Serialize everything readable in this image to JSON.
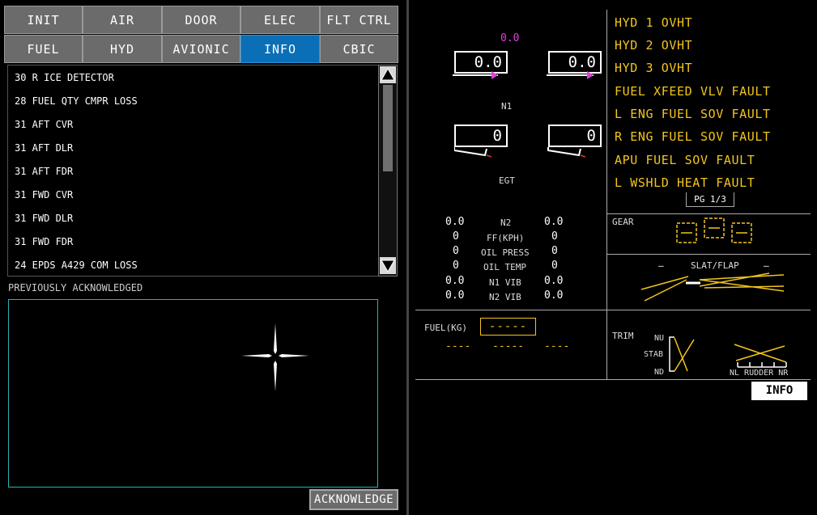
{
  "tabs_row1": [
    "INIT",
    "AIR",
    "DOOR",
    "ELEC",
    "FLT CTRL"
  ],
  "tabs_row2": [
    "FUEL",
    "HYD",
    "AVIONIC",
    "INFO",
    "CBIC"
  ],
  "active_tab": "INFO",
  "messages": [
    "30 R ICE DETECTOR",
    "28 FUEL QTY CMPR LOSS",
    "31 AFT CVR",
    "31 AFT DLR",
    "31 AFT FDR",
    "31 FWD CVR",
    "31 FWD DLR",
    "31 FWD FDR",
    "24 EPDS A429 COM LOSS"
  ],
  "prev_ack_label": "PREVIOUSLY ACKNOWLEDGED",
  "ack_button": "ACKNOWLEDGE",
  "engine": {
    "top_magenta": "0.0",
    "n1_left": "0.0",
    "n1_right": "0.0",
    "n1_label": "N1",
    "egt_left": "0",
    "egt_right": "0",
    "egt_label": "EGT",
    "params": [
      {
        "left": "0.0",
        "label": "N2",
        "right": "0.0"
      },
      {
        "left": "0",
        "label": "FF(KPH)",
        "right": "0"
      },
      {
        "left": "0",
        "label": "OIL PRESS",
        "right": "0"
      },
      {
        "left": "0",
        "label": "OIL TEMP",
        "right": "0"
      },
      {
        "left": "0.0",
        "label": "N1 VIB",
        "right": "0.0"
      },
      {
        "left": "0.0",
        "label": "N2 VIB",
        "right": "0.0"
      }
    ]
  },
  "alerts": [
    "HYD 1 OVHT",
    "HYD 2 OVHT",
    "HYD 3 OVHT",
    "FUEL XFEED VLV FAULT",
    "L ENG FUEL SOV FAULT",
    "R ENG FUEL SOV FAULT",
    "APU FUEL SOV FAULT",
    "L WSHLD HEAT FAULT"
  ],
  "page_indicator": "PG 1/3",
  "gear_label": "GEAR",
  "slat_flap_label": "SLAT/FLAP",
  "slat_left_dash": "–",
  "slat_right_dash": "–",
  "fuel_label": "FUEL(KG)",
  "fuel_total": "-----",
  "fuel_tanks": [
    "----",
    "-----",
    "----"
  ],
  "trim_label": "TRIM",
  "trim_nu": "NU",
  "trim_stab": "STAB",
  "trim_nd": "ND",
  "rudder_label": "NL RUDDER NR",
  "page_badge": "INFO",
  "colors": {
    "active_tab": "#0a6fb7",
    "tab": "#6b6b6b",
    "alert_amber": "#f2c51c",
    "magenta": "#e040e0",
    "ack_box_border": "#2bb3b3"
  }
}
